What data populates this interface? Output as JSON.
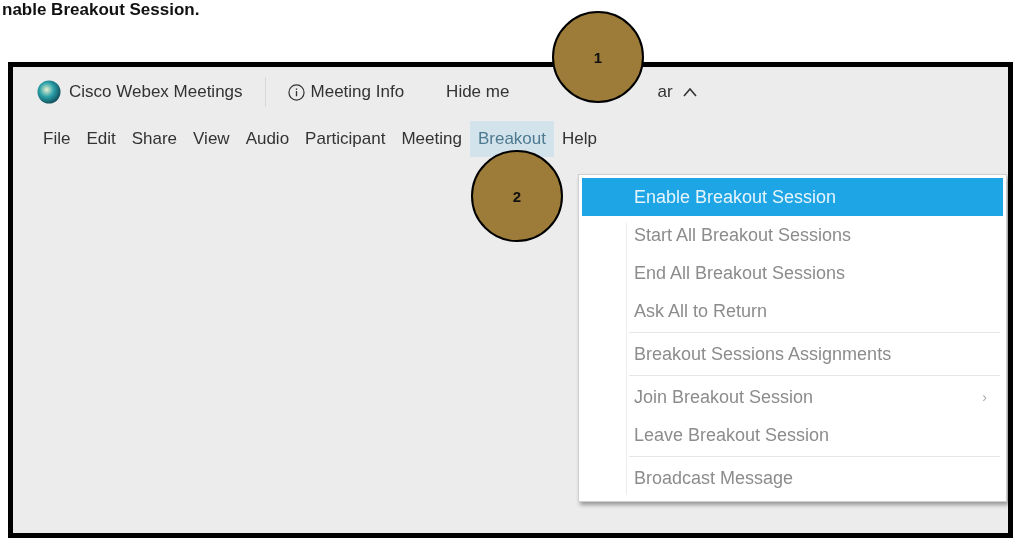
{
  "caption": "nable Breakout Session.",
  "toolbar": {
    "app_name": "Cisco Webex Meetings",
    "meeting_info": "Meeting Info",
    "hide_menu_bar": [
      "Hide me",
      "ar"
    ]
  },
  "menu_bar": [
    {
      "label": "File",
      "selected": false
    },
    {
      "label": "Edit",
      "selected": false
    },
    {
      "label": "Share",
      "selected": false
    },
    {
      "label": "View",
      "selected": false
    },
    {
      "label": "Audio",
      "selected": false
    },
    {
      "label": "Participant",
      "selected": false
    },
    {
      "label": "Meeting",
      "selected": false
    },
    {
      "label": "Breakout",
      "selected": true
    },
    {
      "label": "Help",
      "selected": false
    }
  ],
  "dropdown": {
    "groups": [
      [
        {
          "label": "Enable Breakout Session",
          "selected": true,
          "disabled": false
        },
        {
          "label": "Start All Breakout Sessions",
          "selected": false,
          "disabled": true
        },
        {
          "label": "End All Breakout Sessions",
          "selected": false,
          "disabled": true
        },
        {
          "label": "Ask All to Return",
          "selected": false,
          "disabled": true
        }
      ],
      [
        {
          "label": "Breakout Sessions Assignments",
          "selected": false,
          "disabled": true
        }
      ],
      [
        {
          "label": "Join Breakout Session",
          "selected": false,
          "disabled": true,
          "arrow": "›"
        },
        {
          "label": "Leave Breakout Session",
          "selected": false,
          "disabled": true
        }
      ],
      [
        {
          "label": "Broadcast Message",
          "selected": false,
          "disabled": true
        }
      ]
    ]
  },
  "callouts": [
    "1",
    "2"
  ]
}
